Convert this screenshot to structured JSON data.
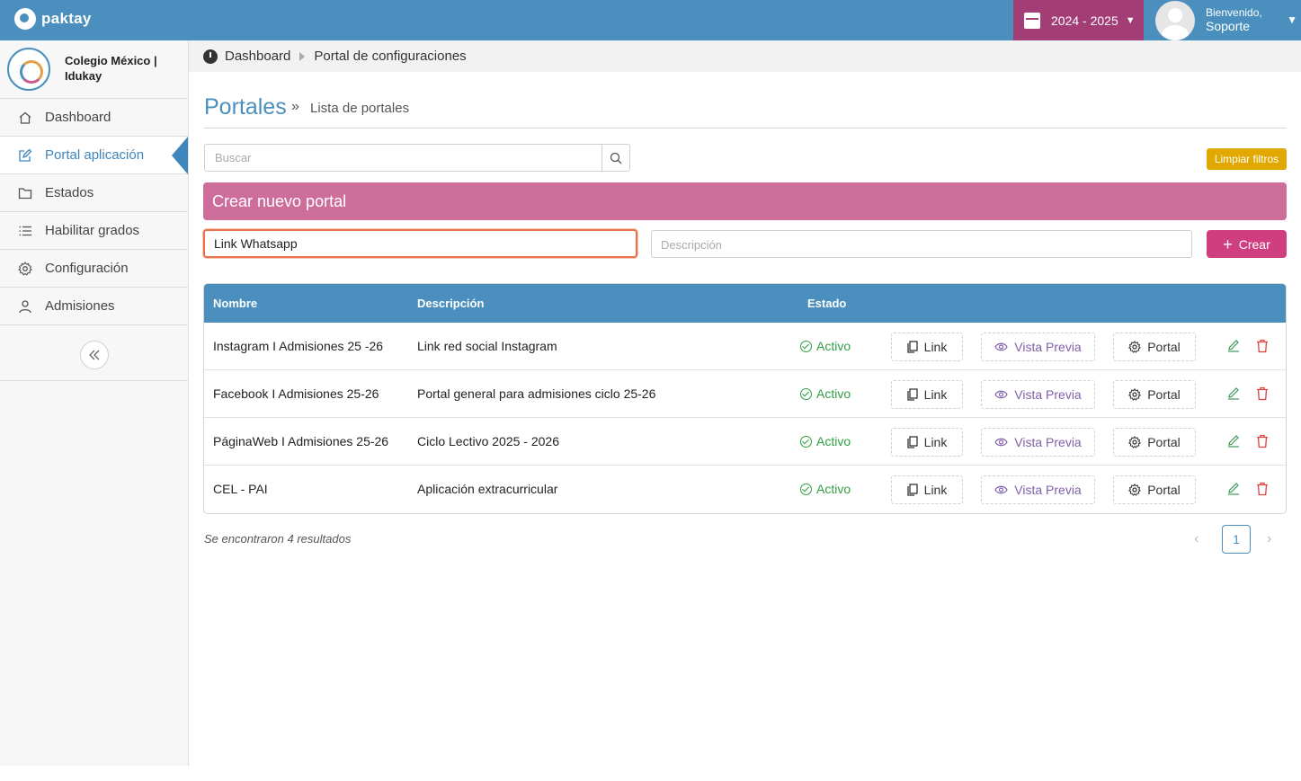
{
  "app": {
    "name": "paktay"
  },
  "header": {
    "year": "2024 - 2025",
    "welcome": "Bienvenido,",
    "user_name": "Soporte"
  },
  "sidebar": {
    "school_name": "Colegio México | Idukay",
    "items": [
      {
        "label": "Dashboard",
        "icon": "home-icon",
        "active": false
      },
      {
        "label": "Portal aplicación",
        "icon": "edit-icon",
        "active": true
      },
      {
        "label": "Estados",
        "icon": "folder-icon",
        "active": false
      },
      {
        "label": "Habilitar grados",
        "icon": "list-icon",
        "active": false
      },
      {
        "label": "Configuración",
        "icon": "gear-icon",
        "active": false
      },
      {
        "label": "Admisiones",
        "icon": "user-icon",
        "active": false
      }
    ],
    "collapse_icon": "double-chevron-left-icon"
  },
  "breadcrumb": {
    "root": "Dashboard",
    "current": "Portal de configuraciones"
  },
  "page": {
    "title": "Portales",
    "separator": "»",
    "subtitle": "Lista de portales"
  },
  "search": {
    "placeholder": "Buscar",
    "value": ""
  },
  "filters": {
    "clear_label": "Limpiar filtros"
  },
  "create": {
    "header": "Crear nuevo portal",
    "name_value": "Link Whatsapp",
    "desc_placeholder": "Descripción",
    "button_label": "Crear"
  },
  "table": {
    "headers": {
      "name": "Nombre",
      "description": "Descripción",
      "status": "Estado"
    },
    "rows": [
      {
        "name": "Instagram I Admisiones 25 -26",
        "description": "Link red social Instagram",
        "status": "Activo"
      },
      {
        "name": "Facebook I Admisiones 25-26",
        "description": "Portal general para admisiones ciclo 25-26",
        "status": "Activo"
      },
      {
        "name": "PáginaWeb I Admisiones 25-26",
        "description": "Ciclo Lectivo 2025 - 2026",
        "status": "Activo"
      },
      {
        "name": "CEL - PAI",
        "description": "Aplicación extracurricular",
        "status": "Activo"
      }
    ],
    "actions": {
      "link": "Link",
      "preview": "Vista Previa",
      "portal": "Portal"
    }
  },
  "footer": {
    "results": "Se encontraron 4 resultados",
    "page": "1"
  },
  "colors": {
    "primary": "#4a8fbd",
    "year_bg": "#a33d75",
    "create_header": "#cd6e9a",
    "create_button": "#cf3f7f",
    "clear_filters": "#e0a800",
    "active_status": "#2e9e44",
    "focus_border": "#e8704a"
  }
}
